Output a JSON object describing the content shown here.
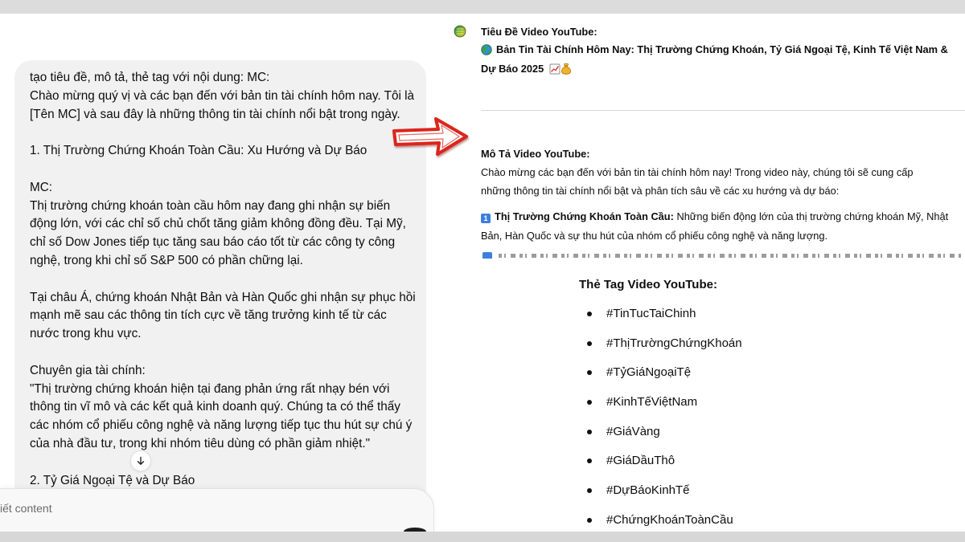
{
  "colors": {
    "arrow_red": "#d9251b",
    "keycap_blue": "#3d7fe0",
    "bubble_bg": "#f1f1f1",
    "frame_gray": "#dcdcdc"
  },
  "user_message": {
    "paragraphs": [
      [
        "tạo tiêu đề, mô tả, thẻ tag với nội dung: MC:",
        "Chào mừng quý vị và các bạn đến với bản tin tài chính hôm nay. Tôi là",
        "[Tên MC] và sau đây là những thông tin tài chính nổi bật trong ngày."
      ],
      [
        "1. Thị Trường Chứng Khoán Toàn Cầu: Xu Hướng và Dự Báo"
      ],
      [
        "MC:",
        "Thị trường chứng khoán toàn cầu hôm nay đang ghi nhận sự biến",
        "động lớn, với các chỉ số chủ chốt tăng giảm không đồng đều. Tại Mỹ,",
        "chỉ số Dow Jones tiếp tục tăng sau báo cáo tốt từ các công ty công",
        "nghệ, trong khi chỉ số S&P 500 có phần chững lại."
      ],
      [
        "Tại châu Á, chứng khoán Nhật Bản và Hàn Quốc ghi nhận sự phục hồi",
        "mạnh mẽ sau các thông tin tích cực về tăng trưởng kinh tế từ các",
        "nước trong khu vực."
      ],
      [
        "Chuyên gia tài chính:",
        "\"Thị trường chứng khoán hiện tại đang phản ứng rất nhạy bén với",
        "thông tin vĩ mô và các kết quả kinh doanh quý. Chúng ta có thể thấy",
        "các nhóm cổ phiếu công nghệ và năng lượng tiếp tục thu hút sự chú ý",
        "của nhà đầu tư, trong khi nhóm tiêu dùng có phần giảm nhiệt.\""
      ],
      [
        "2. Tỷ Giá Ngoại Tệ và Dự Báo"
      ]
    ],
    "scroll_icon": "arrow-down-icon"
  },
  "composer": {
    "placeholder": "iết content",
    "send_icon": "send-button"
  },
  "response": {
    "avatar_icon": "assistant-avatar-icon",
    "title": {
      "heading": "Tiêu Đề Video YouTube:",
      "leading_icon": "globe-icon",
      "lines": [
        "Bản Tin Tài Chính Hôm Nay: Thị Trường Chứng Khoán, Tỷ Giá Ngoại Tệ, Kinh Tế Việt Nam &",
        "Dự Báo 2025"
      ],
      "trailing_icons": [
        "chart-increasing-icon",
        "money-bag-icon"
      ]
    },
    "description": {
      "heading": "Mô Tả Video YouTube:",
      "lines": [
        "Chào mừng các bạn đến với bản tin tài chính hôm nay! Trong video này, chúng tôi sẽ cung cấp",
        "những thông tin tài chính nổi bật và phân tích sâu về các xu hướng và dự báo:"
      ],
      "item_1": {
        "keycap": "1",
        "bold": "Thị Trường Chứng Khoán Toàn Cầu:",
        "text_lines": [
          "Những biến động lớn của thị trường chứng khoán Mỹ, Nhật",
          "Bản, Hàn Quốc và sự thu hút của nhóm cổ phiếu công nghệ và năng lượng."
        ]
      }
    }
  },
  "tags": {
    "heading": "Thẻ Tag Video YouTube:",
    "items": [
      "#TinTucTaiChinh",
      "#ThịTrườngChứngKhoán",
      "#TỷGiáNgoạiTệ",
      "#KinhTếViệtNam",
      "#GiáVàng",
      "#GiáDầuThô",
      "#DựBáoKinhTế",
      "#ChứngKhoánToànCầu"
    ]
  }
}
